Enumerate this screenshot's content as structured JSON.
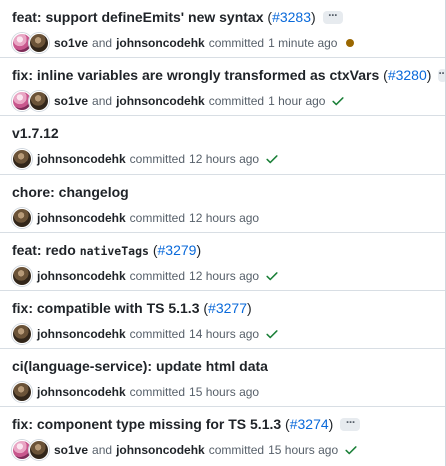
{
  "colors": {
    "link": "#0969da",
    "success": "#1a7f37",
    "pending": "#9a6700",
    "muted": "#57606a",
    "text": "#1f2328"
  },
  "commits": [
    {
      "title": "feat: support defineEmits' new syntax",
      "pr": "#3283",
      "ellipsis": "···",
      "author_primary": "so1ve",
      "and_word": "and",
      "author_secondary": "johnsoncodehk",
      "committed_word": "committed",
      "time": "1 minute ago",
      "status": "pending-icon"
    },
    {
      "title": "fix: inline variables are wrongly transformed as ctxVars",
      "pr": "#3280",
      "ellipsis": "···",
      "author_primary": "so1ve",
      "and_word": "and",
      "author_secondary": "johnsoncodehk",
      "committed_word": "committed",
      "time": "1 hour ago",
      "status": "check-icon"
    },
    {
      "title": "v1.7.12",
      "author_secondary": "johnsoncodehk",
      "committed_word": "committed",
      "time": "12 hours ago",
      "status": "check-icon"
    },
    {
      "title": "chore: changelog",
      "author_secondary": "johnsoncodehk",
      "committed_word": "committed",
      "time": "12 hours ago",
      "status": "none"
    },
    {
      "title_prefix": "feat: redo",
      "title_code": "nativeTags",
      "pr": "#3279",
      "author_secondary": "johnsoncodehk",
      "committed_word": "committed",
      "time": "12 hours ago",
      "status": "check-icon"
    },
    {
      "title": "fix: compatible with TS 5.1.3",
      "pr": "#3277",
      "author_secondary": "johnsoncodehk",
      "committed_word": "committed",
      "time": "14 hours ago",
      "status": "check-icon"
    },
    {
      "title": "ci(language-service): update html data",
      "author_secondary": "johnsoncodehk",
      "committed_word": "committed",
      "time": "15 hours ago",
      "status": "none"
    },
    {
      "title": "fix: component type missing for TS 5.1.3",
      "pr": "#3274",
      "ellipsis": "···",
      "author_primary": "so1ve",
      "and_word": "and",
      "author_secondary": "johnsoncodehk",
      "committed_word": "committed",
      "time": "15 hours ago",
      "status": "check-icon"
    }
  ]
}
